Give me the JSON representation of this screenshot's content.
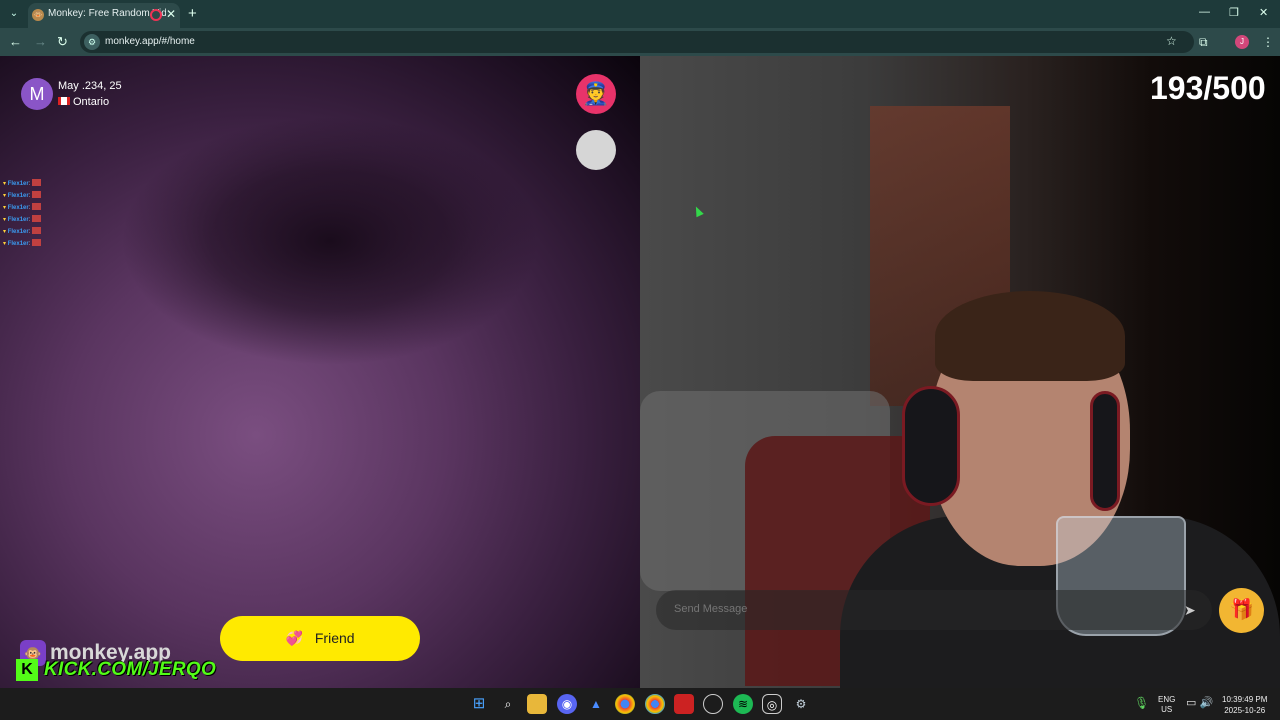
{
  "browser": {
    "tab_title": "Monkey: Free Random Vide",
    "tab_close": "✕",
    "new_tab": "+",
    "url": "monkey.app/#/home",
    "window_controls": {
      "minimize": "—",
      "maximize": "❐",
      "close": "✕"
    },
    "profile_initial": "J"
  },
  "peer": {
    "avatar_initial": "M",
    "date": "May .234, 25",
    "location": "Ontario"
  },
  "chat_log": {
    "header": "",
    "lines": [
      {
        "user": "Flex1er"
      },
      {
        "user": "Flex1er"
      },
      {
        "user": "Flex1er"
      },
      {
        "user": "Flex1er"
      },
      {
        "user": "Flex1er"
      },
      {
        "user": "Flex1er"
      }
    ]
  },
  "friend_button": {
    "label": "Friend"
  },
  "branding": {
    "monkey_text": "monkey.app",
    "kick_letter": "K",
    "kick_text": "KICK.COM/JERQO"
  },
  "counter": "193/500",
  "message_bar": {
    "placeholder": "Send Message"
  },
  "taskbar": {
    "language": [
      "ENG",
      "US"
    ],
    "time": "10:39:49 PM",
    "date": "2025-10-26"
  },
  "colors": {
    "accent_pink": "#e8336a",
    "friend_yellow": "#ffea00",
    "kick_green": "#53fc18",
    "gift_gold": "#f2b632"
  }
}
